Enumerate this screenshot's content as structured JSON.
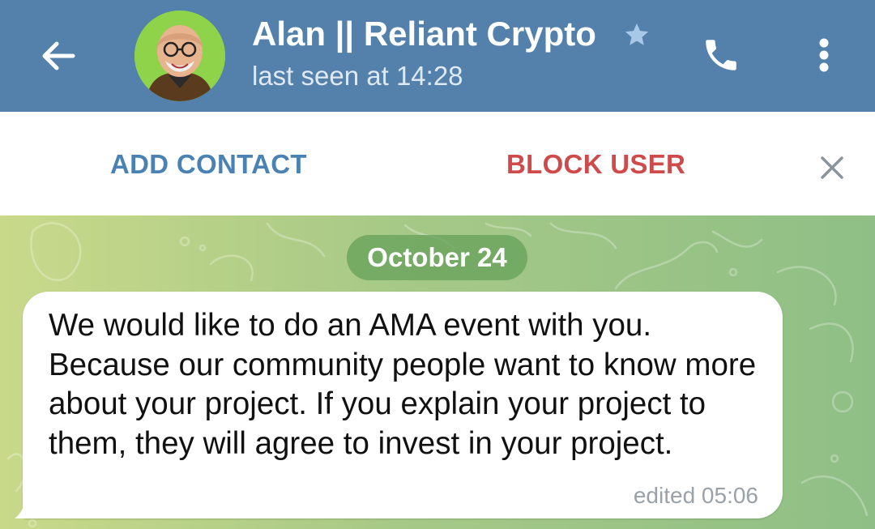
{
  "header": {
    "back_icon": "arrow-left-icon",
    "avatar_icon": "user-avatar",
    "title": "Alan || Reliant Crypto",
    "star_icon": "star-icon",
    "status": "last seen at 14:28",
    "call_icon": "phone-icon",
    "menu_icon": "more-vertical-icon",
    "color": "#5381ab"
  },
  "actions": {
    "add_contact": "ADD CONTACT",
    "block_user": "BLOCK USER",
    "close_icon": "close-icon",
    "add_color": "#4a82b3",
    "block_color": "#cf4b4b"
  },
  "chat": {
    "date": "October 24",
    "messages": [
      {
        "text": "We would like to do an AMA event with you. Because our community people want to know more about your project. If you explain your project to them, they will agree to invest in your project.",
        "meta": "edited 05:06"
      }
    ]
  }
}
